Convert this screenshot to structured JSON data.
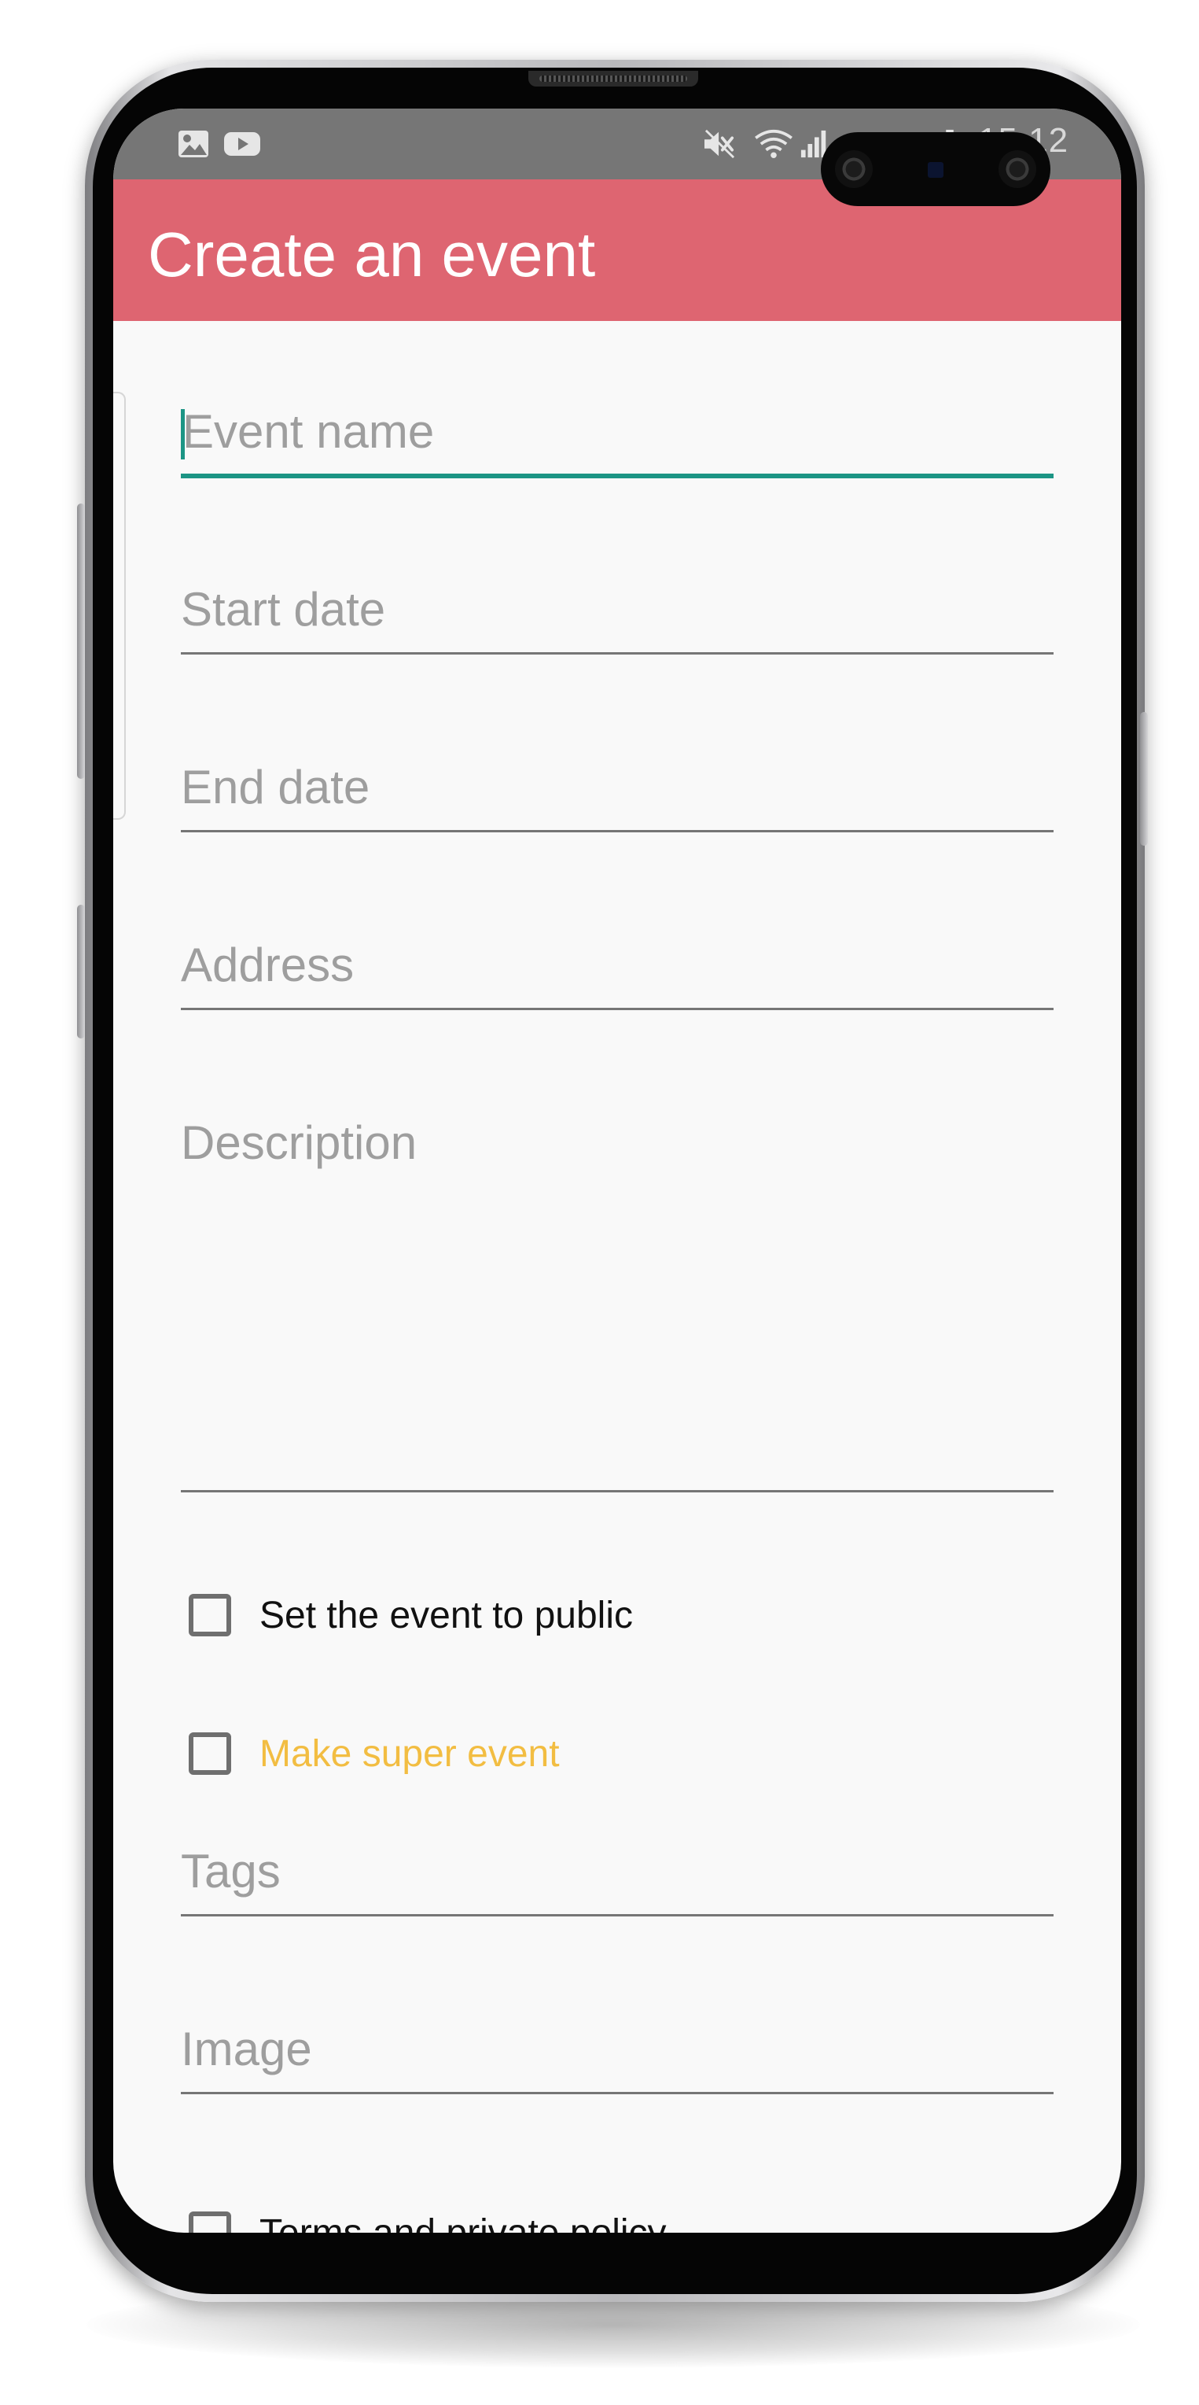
{
  "status_bar": {
    "left_icons": [
      "gallery-icon",
      "youtube-icon"
    ],
    "right_icons": [
      "mute-icon",
      "wifi-icon",
      "signal-icon",
      "battery-icon"
    ],
    "time": "15:12",
    "background_color": "#767676"
  },
  "app_bar": {
    "title": "Create an event",
    "background_color": "#de6571"
  },
  "form": {
    "event_name": {
      "placeholder": "Event name",
      "value": "",
      "focused": true
    },
    "start_date": {
      "placeholder": "Start date",
      "value": ""
    },
    "end_date": {
      "placeholder": "End date",
      "value": ""
    },
    "address": {
      "placeholder": "Address",
      "value": ""
    },
    "description": {
      "placeholder": "Description",
      "value": ""
    },
    "public_checkbox": {
      "label": "Set the event to public",
      "checked": false
    },
    "super_event_checkbox": {
      "label": "Make super event",
      "checked": false,
      "label_color": "#f2bd42"
    },
    "tags": {
      "placeholder": "Tags",
      "value": ""
    },
    "image": {
      "placeholder": "Image",
      "value": ""
    },
    "terms_checkbox": {
      "label": "Terms and private policy",
      "checked": false
    }
  },
  "colors": {
    "accent": "#1c9585",
    "underline": "#767676",
    "page_background": "#f9f9f9"
  }
}
